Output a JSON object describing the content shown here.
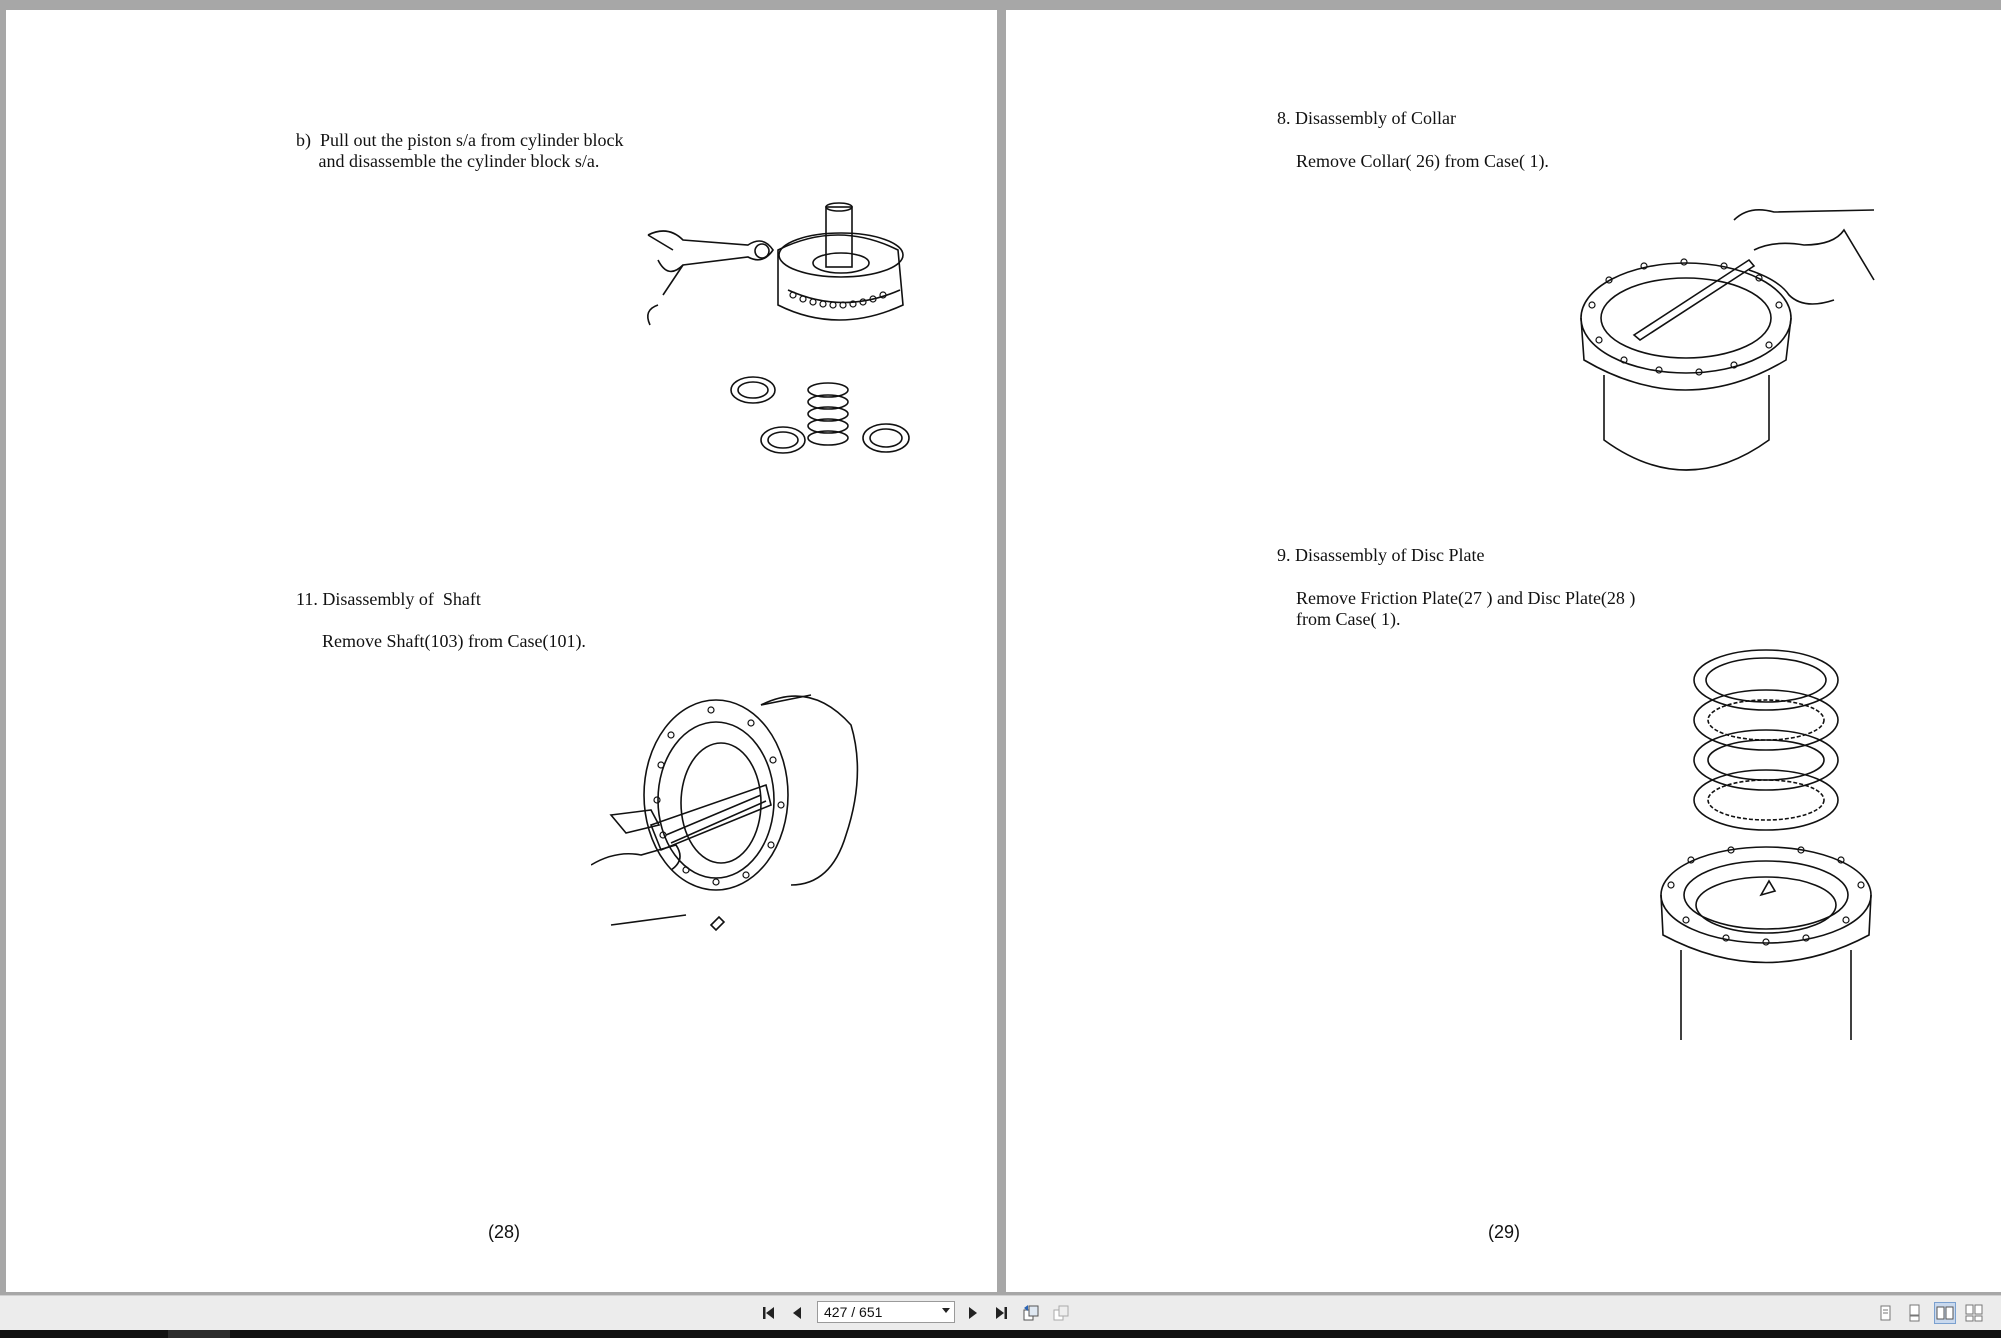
{
  "left_page": {
    "step_b": "b)  Pull out the piston s/a from cylinder block\n     and disassemble the cylinder block s/a.",
    "step11_title": "11. Disassembly of  Shaft",
    "step11_body": "Remove Shaft(103) from Case(101).",
    "page_number": "(28)"
  },
  "right_page": {
    "step8_title": "8. Disassembly of Collar",
    "step8_body": "Remove Collar( 26) from Case( 1).",
    "step9_title": "9. Disassembly of Disc Plate",
    "step9_body": "Remove Friction Plate(27 ) and Disc Plate(28 )\nfrom Case( 1).",
    "page_number": "(29)"
  },
  "toolbar": {
    "page_field": "427 / 651",
    "icons": [
      "first-page-icon",
      "previous-page-icon",
      "next-page-icon",
      "last-page-icon",
      "previous-view-icon",
      "next-view-icon",
      "single-page-icon",
      "continuous-page-icon",
      "two-page-icon",
      "two-page-continuous-icon"
    ]
  }
}
